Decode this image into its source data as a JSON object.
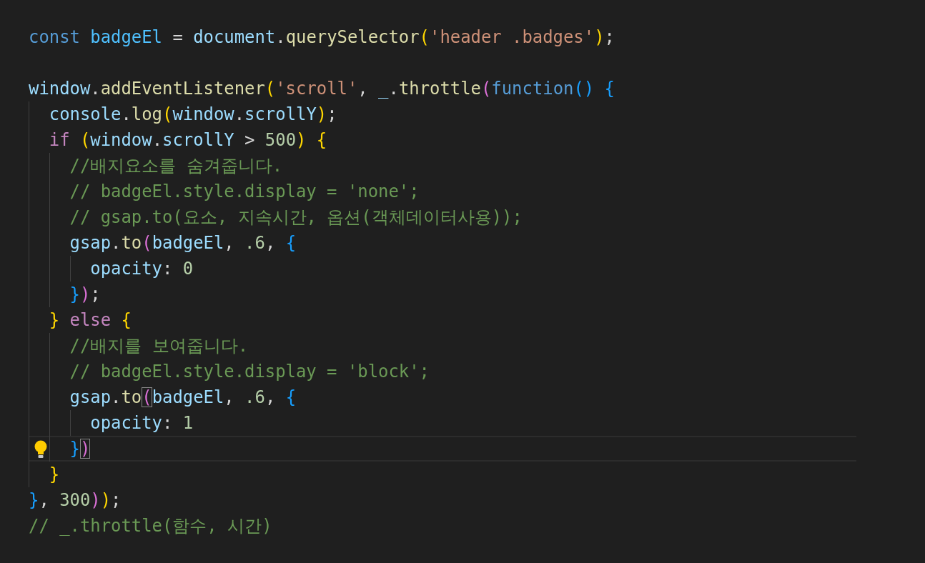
{
  "editor": {
    "lines": [
      {
        "kind": "code",
        "tokens": [
          {
            "kind": "storage",
            "text": "const "
          },
          {
            "kind": "constant",
            "text": "badgeEl"
          },
          {
            "kind": "plain",
            "text": " = "
          },
          {
            "kind": "variable",
            "text": "document"
          },
          {
            "kind": "plain",
            "text": "."
          },
          {
            "kind": "function",
            "text": "querySelector"
          },
          {
            "kind": "bracket1",
            "text": "("
          },
          {
            "kind": "string",
            "text": "'header .badges'"
          },
          {
            "kind": "bracket1",
            "text": ")"
          },
          {
            "kind": "plain",
            "text": ";"
          }
        ]
      },
      {
        "kind": "blank"
      },
      {
        "kind": "code",
        "tokens": [
          {
            "kind": "variable",
            "text": "window"
          },
          {
            "kind": "plain",
            "text": "."
          },
          {
            "kind": "function",
            "text": "addEventListener"
          },
          {
            "kind": "bracket1",
            "text": "("
          },
          {
            "kind": "string",
            "text": "'scroll'"
          },
          {
            "kind": "plain",
            "text": ", "
          },
          {
            "kind": "variable",
            "text": "_"
          },
          {
            "kind": "plain",
            "text": "."
          },
          {
            "kind": "function",
            "text": "throttle"
          },
          {
            "kind": "bracket2",
            "text": "("
          },
          {
            "kind": "storage",
            "text": "function"
          },
          {
            "kind": "bracket3",
            "text": "() "
          },
          {
            "kind": "bracket3",
            "text": "{"
          }
        ]
      },
      {
        "kind": "code",
        "tokens": [
          {
            "kind": "variable",
            "text": "  console"
          },
          {
            "kind": "plain",
            "text": "."
          },
          {
            "kind": "function",
            "text": "log"
          },
          {
            "kind": "bracket1",
            "text": "("
          },
          {
            "kind": "variable",
            "text": "window"
          },
          {
            "kind": "plain",
            "text": "."
          },
          {
            "kind": "variable",
            "text": "scrollY"
          },
          {
            "kind": "bracket1",
            "text": ")"
          },
          {
            "kind": "plain",
            "text": ";"
          }
        ]
      },
      {
        "kind": "code",
        "tokens": [
          {
            "kind": "control",
            "text": "  if "
          },
          {
            "kind": "bracket1",
            "text": "("
          },
          {
            "kind": "variable",
            "text": "window"
          },
          {
            "kind": "plain",
            "text": "."
          },
          {
            "kind": "variable",
            "text": "scrollY"
          },
          {
            "kind": "plain",
            "text": " > "
          },
          {
            "kind": "number",
            "text": "500"
          },
          {
            "kind": "bracket1",
            "text": ") "
          },
          {
            "kind": "bracket1",
            "text": "{"
          }
        ]
      },
      {
        "kind": "code",
        "tokens": [
          {
            "kind": "comment",
            "text": "    //배지요소를 숨겨줍니다."
          }
        ]
      },
      {
        "kind": "code",
        "tokens": [
          {
            "kind": "comment",
            "text": "    // badgeEl.style.display = 'none';"
          }
        ]
      },
      {
        "kind": "code",
        "tokens": [
          {
            "kind": "comment",
            "text": "    // gsap.to(요소, 지속시간, 옵션(객체데이터사용));"
          }
        ]
      },
      {
        "kind": "code",
        "tokens": [
          {
            "kind": "variable",
            "text": "    gsap"
          },
          {
            "kind": "plain",
            "text": "."
          },
          {
            "kind": "function",
            "text": "to"
          },
          {
            "kind": "bracket2",
            "text": "("
          },
          {
            "kind": "variable",
            "text": "badgeEl"
          },
          {
            "kind": "plain",
            "text": ", "
          },
          {
            "kind": "number",
            "text": ".6"
          },
          {
            "kind": "plain",
            "text": ", "
          },
          {
            "kind": "bracket3",
            "text": "{"
          }
        ]
      },
      {
        "kind": "code",
        "tokens": [
          {
            "kind": "variable",
            "text": "      opacity"
          },
          {
            "kind": "plain",
            "text": ": "
          },
          {
            "kind": "number",
            "text": "0"
          }
        ]
      },
      {
        "kind": "code",
        "tokens": [
          {
            "kind": "bracket3",
            "text": "    }"
          },
          {
            "kind": "bracket2",
            "text": ")"
          },
          {
            "kind": "plain",
            "text": ";"
          }
        ]
      },
      {
        "kind": "code",
        "tokens": [
          {
            "kind": "bracket1",
            "text": "  } "
          },
          {
            "kind": "control",
            "text": "else "
          },
          {
            "kind": "bracket1",
            "text": "{"
          }
        ]
      },
      {
        "kind": "code",
        "tokens": [
          {
            "kind": "comment",
            "text": "    //배지를 보여줍니다."
          }
        ]
      },
      {
        "kind": "code",
        "tokens": [
          {
            "kind": "comment",
            "text": "    // badgeEl.style.display = 'block';"
          }
        ]
      },
      {
        "kind": "code",
        "tokens": [
          {
            "kind": "variable",
            "text": "    gsap"
          },
          {
            "kind": "plain",
            "text": "."
          },
          {
            "kind": "function",
            "text": "to"
          },
          {
            "kind": "bracket2",
            "text": "(",
            "matched": true
          },
          {
            "kind": "variable",
            "text": "badgeEl"
          },
          {
            "kind": "plain",
            "text": ", "
          },
          {
            "kind": "number",
            "text": ".6"
          },
          {
            "kind": "plain",
            "text": ", "
          },
          {
            "kind": "bracket3",
            "text": "{"
          }
        ]
      },
      {
        "kind": "code",
        "tokens": [
          {
            "kind": "variable",
            "text": "      opacity"
          },
          {
            "kind": "plain",
            "text": ": "
          },
          {
            "kind": "number",
            "text": "1"
          }
        ]
      },
      {
        "kind": "code",
        "current": true,
        "lightbulb": true,
        "tokens": [
          {
            "kind": "bracket3",
            "text": "    }"
          },
          {
            "kind": "bracket2",
            "text": ")",
            "matched": true
          }
        ]
      },
      {
        "kind": "code",
        "tokens": [
          {
            "kind": "bracket1",
            "text": "  }"
          }
        ]
      },
      {
        "kind": "code",
        "tokens": [
          {
            "kind": "bracket3",
            "text": "}"
          },
          {
            "kind": "plain",
            "text": ", "
          },
          {
            "kind": "number",
            "text": "300"
          },
          {
            "kind": "bracket2",
            "text": ")"
          },
          {
            "kind": "bracket1",
            "text": ")"
          },
          {
            "kind": "plain",
            "text": ";"
          }
        ]
      },
      {
        "kind": "code",
        "tokens": [
          {
            "kind": "comment",
            "text": "// _.throttle(함수, 시간)"
          }
        ]
      }
    ]
  }
}
